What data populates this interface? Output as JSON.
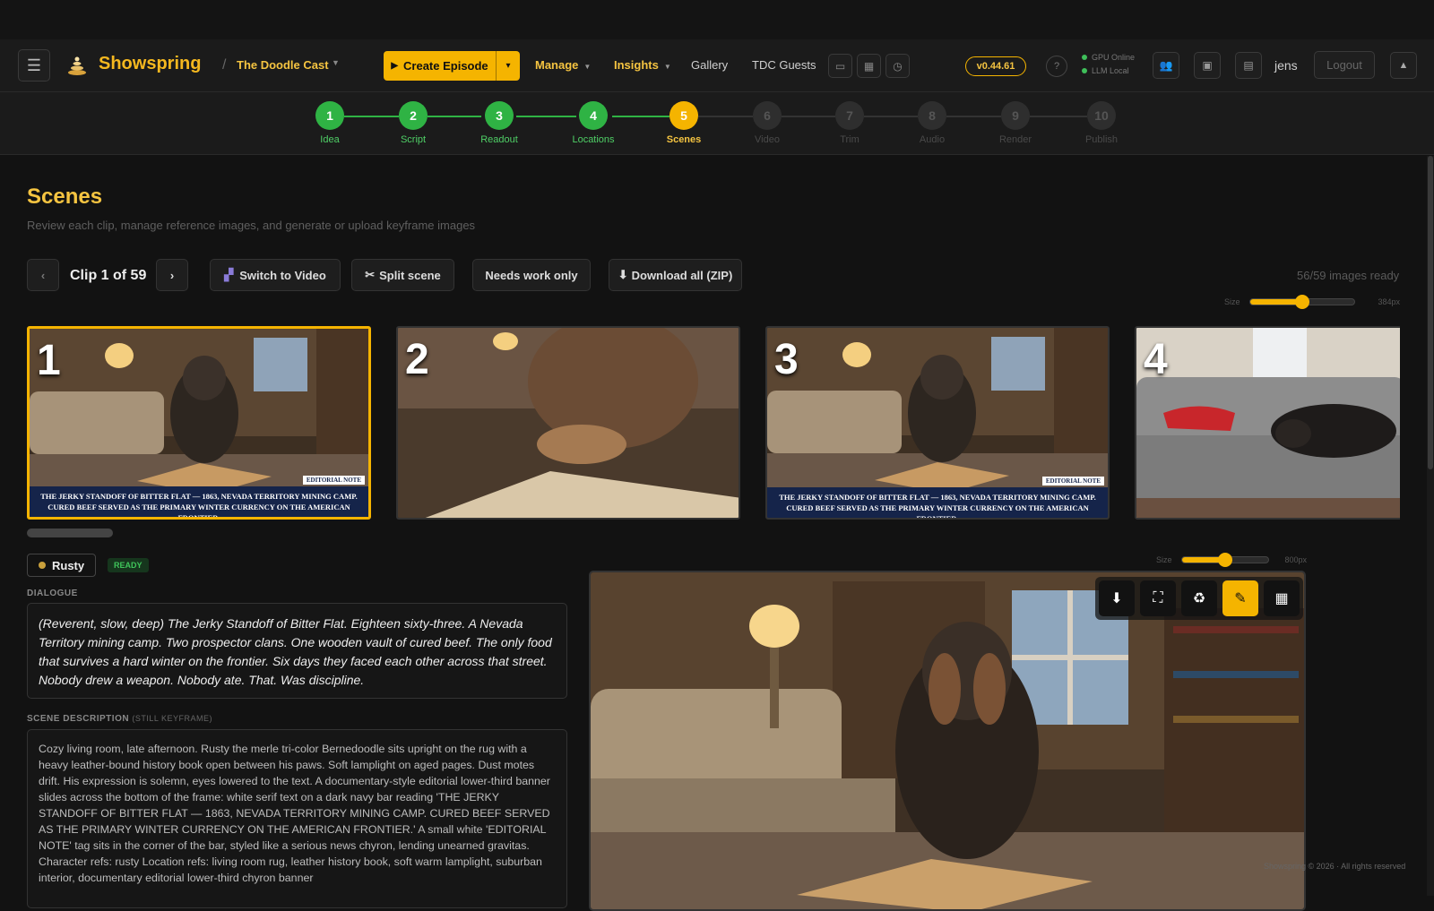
{
  "header": {
    "app_name": "Showspring",
    "project": "The Doodle Cast",
    "create_label": "Create Episode",
    "nav": [
      {
        "label": "Manage",
        "caret": true
      },
      {
        "label": "Insights",
        "caret": true
      },
      {
        "label": "Gallery"
      },
      {
        "label": "TDC Guests"
      }
    ],
    "version": "v0.44.61",
    "help": "?",
    "status": [
      "GPU Online",
      "LLM Local"
    ],
    "user": "jens",
    "logout": "Logout"
  },
  "steps": [
    {
      "n": "1",
      "label": "Idea",
      "state": "done"
    },
    {
      "n": "2",
      "label": "Script",
      "state": "done"
    },
    {
      "n": "3",
      "label": "Readout",
      "state": "done"
    },
    {
      "n": "4",
      "label": "Locations",
      "state": "done"
    },
    {
      "n": "5",
      "label": "Scenes",
      "state": "active"
    },
    {
      "n": "6",
      "label": "Video",
      "state": "todo"
    },
    {
      "n": "7",
      "label": "Trim",
      "state": "todo"
    },
    {
      "n": "8",
      "label": "Audio",
      "state": "todo"
    },
    {
      "n": "9",
      "label": "Render",
      "state": "todo"
    },
    {
      "n": "10",
      "label": "Publish",
      "state": "todo"
    }
  ],
  "page": {
    "title": "Scenes",
    "subtitle": "Review each clip, manage reference images, and generate or upload keyframe images"
  },
  "toolbar": {
    "prev": "‹",
    "clip_label": "Clip 1 of 59",
    "next": "›",
    "switch_video": "Switch to Video",
    "split_scene": "Split scene",
    "needs_work": "Needs work only",
    "download_all": "Download all (ZIP)",
    "ready_count": "56/59 images ready"
  },
  "thumb_size": {
    "label": "Size",
    "value": "384px",
    "level": 0.5
  },
  "thumbnails": [
    {
      "num": "1",
      "selected": true,
      "kind": "dog-book",
      "chyron": true
    },
    {
      "num": "2",
      "selected": false,
      "kind": "dog-close",
      "chyron": false
    },
    {
      "num": "3",
      "selected": false,
      "kind": "dog-book",
      "chyron": true
    },
    {
      "num": "4",
      "selected": false,
      "kind": "dog-sofa",
      "chyron": false
    }
  ],
  "chyron": {
    "line1": "THE JERKY STANDOFF OF BITTER FLAT — 1863, NEVADA TERRITORY MINING CAMP.",
    "line2": "CURED BEEF SERVED AS THE PRIMARY WINTER CURRENCY ON THE AMERICAN FRONTIER.",
    "tag": "EDITORIAL NOTE"
  },
  "clip": {
    "character": "Rusty",
    "status": "READY",
    "dialogue_label": "DIALOGUE",
    "dialogue": "(Reverent, slow, deep) The Jerky Standoff of Bitter Flat. Eighteen sixty-three. A Nevada Territory mining camp. Two prospector clans. One wooden vault of cured beef. The only food that survives a hard winter on the frontier. Six days they faced each other across that street. Nobody drew a weapon. Nobody ate. That. Was discipline.",
    "desc_label": "SCENE DESCRIPTION",
    "desc_sub": "(STILL KEYFRAME)",
    "description": "Cozy living room, late afternoon. Rusty the merle tri-color Bernedoodle sits upright on the rug with a heavy leather-bound history book open between his paws. Soft lamplight on aged pages. Dust motes drift. His expression is solemn, eyes lowered to the text. A documentary-style editorial lower-third banner slides across the bottom of the frame: white serif text on a dark navy bar reading 'THE JERKY STANDOFF OF BITTER FLAT — 1863, NEVADA TERRITORY MINING CAMP. CURED BEEF SERVED AS THE PRIMARY WINTER CURRENCY ON THE AMERICAN FRONTIER.' A small white 'EDITORIAL NOTE' tag sits in the corner of the bar, styled like a serious news chyron, lending unearned gravitas. Character refs: rusty Location refs: living room rug, leather history book, soft warm lamplight, suburban interior, documentary editorial lower-third chyron banner"
  },
  "preview_size": {
    "label": "Size",
    "value": "800px",
    "level": 0.5
  },
  "preview_tools": [
    "download-icon",
    "fullscreen-icon",
    "regenerate-icon",
    "edit-icon",
    "gallery-icon"
  ],
  "footer": "Showspring © 2026 · All rights reserved",
  "colors": {
    "accent": "#f5b400",
    "done": "#2fb344",
    "chyron": "#15244a"
  }
}
